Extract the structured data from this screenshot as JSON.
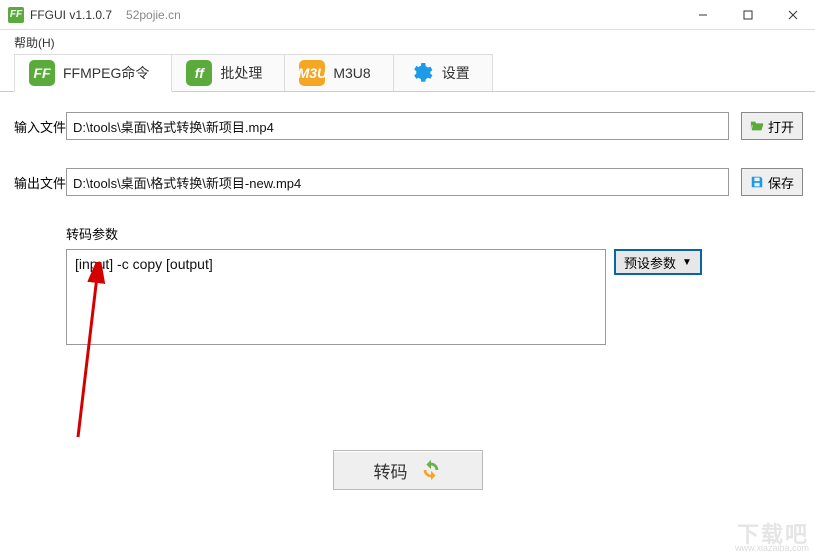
{
  "window": {
    "app_icon_text": "FF",
    "title": "FFGUI v1.1.0.7",
    "subtitle": "52pojie.cn"
  },
  "menu": {
    "help": "帮助(H)"
  },
  "tabs": [
    {
      "icon_text": "FF",
      "label": "FFMPEG命令"
    },
    {
      "icon_text": "ff",
      "label": "批处理"
    },
    {
      "icon_text": "M3U",
      "label": "M3U8"
    },
    {
      "icon_text": "",
      "label": "设置"
    }
  ],
  "input_row": {
    "label": "输入文件",
    "value": "D:\\tools\\桌面\\格式转换\\新项目.mp4",
    "button": "打开"
  },
  "output_row": {
    "label": "输出文件",
    "value": "D:\\tools\\桌面\\格式转换\\新项目-new.mp4",
    "button": "保存"
  },
  "params": {
    "label": "转码参数",
    "value": "[input] -c copy [output]",
    "preset_button": "预设参数"
  },
  "transcode_button": "转码",
  "watermark": "下载吧",
  "watermark_sub": "www.xiazaiba.com"
}
